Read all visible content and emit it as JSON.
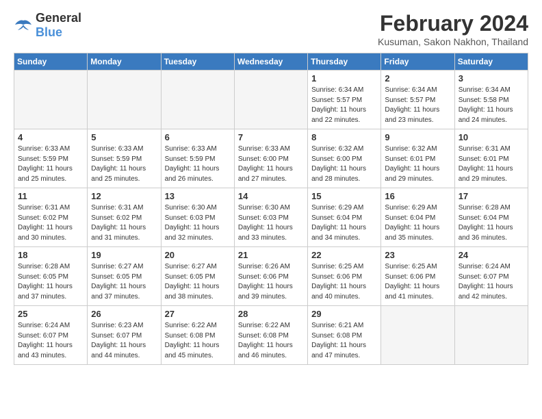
{
  "logo": {
    "general": "General",
    "blue": "Blue"
  },
  "title": {
    "month_year": "February 2024",
    "location": "Kusuman, Sakon Nakhon, Thailand"
  },
  "headers": [
    "Sunday",
    "Monday",
    "Tuesday",
    "Wednesday",
    "Thursday",
    "Friday",
    "Saturday"
  ],
  "weeks": [
    [
      {
        "day": "",
        "info": ""
      },
      {
        "day": "",
        "info": ""
      },
      {
        "day": "",
        "info": ""
      },
      {
        "day": "",
        "info": ""
      },
      {
        "day": "1",
        "info": "Sunrise: 6:34 AM\nSunset: 5:57 PM\nDaylight: 11 hours and 22 minutes."
      },
      {
        "day": "2",
        "info": "Sunrise: 6:34 AM\nSunset: 5:57 PM\nDaylight: 11 hours and 23 minutes."
      },
      {
        "day": "3",
        "info": "Sunrise: 6:34 AM\nSunset: 5:58 PM\nDaylight: 11 hours and 24 minutes."
      }
    ],
    [
      {
        "day": "4",
        "info": "Sunrise: 6:33 AM\nSunset: 5:59 PM\nDaylight: 11 hours and 25 minutes."
      },
      {
        "day": "5",
        "info": "Sunrise: 6:33 AM\nSunset: 5:59 PM\nDaylight: 11 hours and 25 minutes."
      },
      {
        "day": "6",
        "info": "Sunrise: 6:33 AM\nSunset: 5:59 PM\nDaylight: 11 hours and 26 minutes."
      },
      {
        "day": "7",
        "info": "Sunrise: 6:33 AM\nSunset: 6:00 PM\nDaylight: 11 hours and 27 minutes."
      },
      {
        "day": "8",
        "info": "Sunrise: 6:32 AM\nSunset: 6:00 PM\nDaylight: 11 hours and 28 minutes."
      },
      {
        "day": "9",
        "info": "Sunrise: 6:32 AM\nSunset: 6:01 PM\nDaylight: 11 hours and 29 minutes."
      },
      {
        "day": "10",
        "info": "Sunrise: 6:31 AM\nSunset: 6:01 PM\nDaylight: 11 hours and 29 minutes."
      }
    ],
    [
      {
        "day": "11",
        "info": "Sunrise: 6:31 AM\nSunset: 6:02 PM\nDaylight: 11 hours and 30 minutes."
      },
      {
        "day": "12",
        "info": "Sunrise: 6:31 AM\nSunset: 6:02 PM\nDaylight: 11 hours and 31 minutes."
      },
      {
        "day": "13",
        "info": "Sunrise: 6:30 AM\nSunset: 6:03 PM\nDaylight: 11 hours and 32 minutes."
      },
      {
        "day": "14",
        "info": "Sunrise: 6:30 AM\nSunset: 6:03 PM\nDaylight: 11 hours and 33 minutes."
      },
      {
        "day": "15",
        "info": "Sunrise: 6:29 AM\nSunset: 6:04 PM\nDaylight: 11 hours and 34 minutes."
      },
      {
        "day": "16",
        "info": "Sunrise: 6:29 AM\nSunset: 6:04 PM\nDaylight: 11 hours and 35 minutes."
      },
      {
        "day": "17",
        "info": "Sunrise: 6:28 AM\nSunset: 6:04 PM\nDaylight: 11 hours and 36 minutes."
      }
    ],
    [
      {
        "day": "18",
        "info": "Sunrise: 6:28 AM\nSunset: 6:05 PM\nDaylight: 11 hours and 37 minutes."
      },
      {
        "day": "19",
        "info": "Sunrise: 6:27 AM\nSunset: 6:05 PM\nDaylight: 11 hours and 37 minutes."
      },
      {
        "day": "20",
        "info": "Sunrise: 6:27 AM\nSunset: 6:05 PM\nDaylight: 11 hours and 38 minutes."
      },
      {
        "day": "21",
        "info": "Sunrise: 6:26 AM\nSunset: 6:06 PM\nDaylight: 11 hours and 39 minutes."
      },
      {
        "day": "22",
        "info": "Sunrise: 6:25 AM\nSunset: 6:06 PM\nDaylight: 11 hours and 40 minutes."
      },
      {
        "day": "23",
        "info": "Sunrise: 6:25 AM\nSunset: 6:06 PM\nDaylight: 11 hours and 41 minutes."
      },
      {
        "day": "24",
        "info": "Sunrise: 6:24 AM\nSunset: 6:07 PM\nDaylight: 11 hours and 42 minutes."
      }
    ],
    [
      {
        "day": "25",
        "info": "Sunrise: 6:24 AM\nSunset: 6:07 PM\nDaylight: 11 hours and 43 minutes."
      },
      {
        "day": "26",
        "info": "Sunrise: 6:23 AM\nSunset: 6:07 PM\nDaylight: 11 hours and 44 minutes."
      },
      {
        "day": "27",
        "info": "Sunrise: 6:22 AM\nSunset: 6:08 PM\nDaylight: 11 hours and 45 minutes."
      },
      {
        "day": "28",
        "info": "Sunrise: 6:22 AM\nSunset: 6:08 PM\nDaylight: 11 hours and 46 minutes."
      },
      {
        "day": "29",
        "info": "Sunrise: 6:21 AM\nSunset: 6:08 PM\nDaylight: 11 hours and 47 minutes."
      },
      {
        "day": "",
        "info": ""
      },
      {
        "day": "",
        "info": ""
      }
    ]
  ]
}
